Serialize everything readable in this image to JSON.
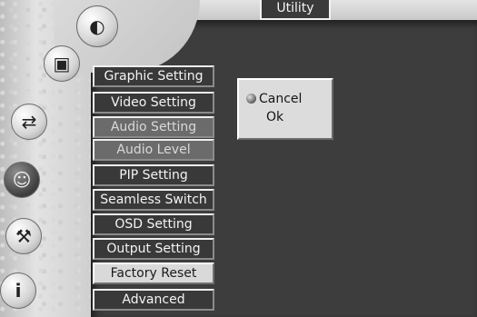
{
  "window": {
    "title": "Utility"
  },
  "sidebar": {
    "icons": [
      {
        "name": "brightness-icon",
        "glyph": "◐"
      },
      {
        "name": "picture-icon",
        "glyph": "▣"
      },
      {
        "name": "input-icon",
        "glyph": "⇄"
      },
      {
        "name": "face-icon",
        "glyph": "☺"
      },
      {
        "name": "tools-icon",
        "glyph": "⚒"
      },
      {
        "name": "info-icon",
        "glyph": "i"
      }
    ]
  },
  "menu": {
    "items": [
      {
        "label": "Graphic Setting",
        "state": "normal"
      },
      {
        "label": "Video Setting",
        "state": "normal"
      },
      {
        "label": "Audio Setting",
        "state": "dim"
      },
      {
        "label": "Audio Level",
        "state": "dim"
      },
      {
        "label": "PIP Setting",
        "state": "normal"
      },
      {
        "label": "Seamless Switch",
        "state": "normal"
      },
      {
        "label": "OSD Setting",
        "state": "normal"
      },
      {
        "label": "Output Setting",
        "state": "normal"
      },
      {
        "label": "Factory Reset",
        "state": "selected"
      },
      {
        "label": "Advanced",
        "state": "normal"
      }
    ]
  },
  "dialog": {
    "cancel_label": "Cancel",
    "ok_label": "Ok"
  }
}
